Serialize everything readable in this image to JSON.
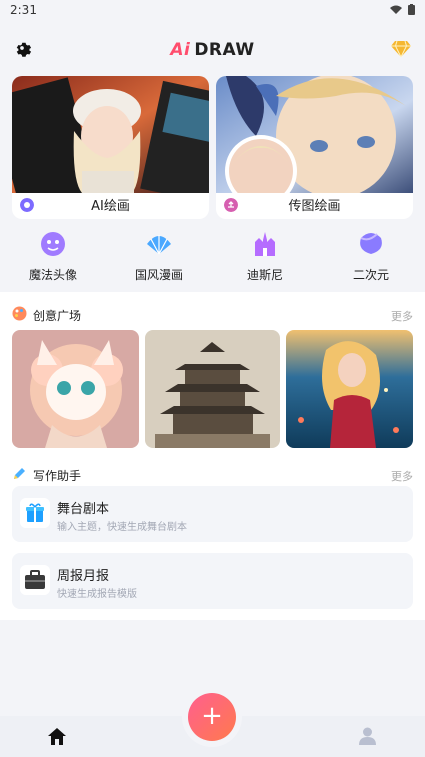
{
  "status_bar": {
    "time": "2:31"
  },
  "header": {
    "logo_ai": "Ai",
    "logo_text": "DRAW"
  },
  "feature_cards": [
    {
      "label": "AI绘画"
    },
    {
      "label": "传图绘画"
    }
  ],
  "categories": [
    {
      "label": "魔法头像"
    },
    {
      "label": "国风漫画"
    },
    {
      "label": "迪斯尼"
    },
    {
      "label": "二次元"
    }
  ],
  "creative_square": {
    "title": "创意广场",
    "more": "更多"
  },
  "writing_assistant": {
    "title": "写作助手",
    "more": "更多",
    "items": [
      {
        "title": "舞台剧本",
        "subtitle": "输入主题，快速生成舞台剧本"
      },
      {
        "title": "周报月报",
        "subtitle": "快速生成报告模版"
      }
    ]
  },
  "colors": {
    "accent": "#ff4d6d",
    "fab": "#ff6a6a"
  }
}
